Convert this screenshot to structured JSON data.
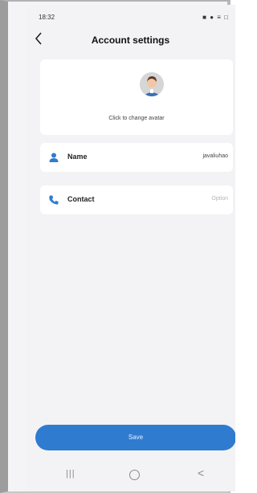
{
  "status_bar": {
    "time": "18:32",
    "icons": "■ ● ≡ □"
  },
  "header": {
    "title": "Account settings",
    "back_icon": "chevron-left-icon"
  },
  "avatar_card": {
    "hint": "Click to change avatar"
  },
  "fields": {
    "name": {
      "label": "Name",
      "value": "javaliuhao",
      "icon": "person-icon",
      "color": "#2f7bd0"
    },
    "contact": {
      "label": "Contact",
      "placeholder": "Option",
      "icon": "phone-icon",
      "color": "#2f7bd0"
    }
  },
  "save_button": {
    "label": "Save",
    "color": "#2f7bd0"
  },
  "nav_bar": {
    "recent": "|||",
    "back": "<"
  }
}
